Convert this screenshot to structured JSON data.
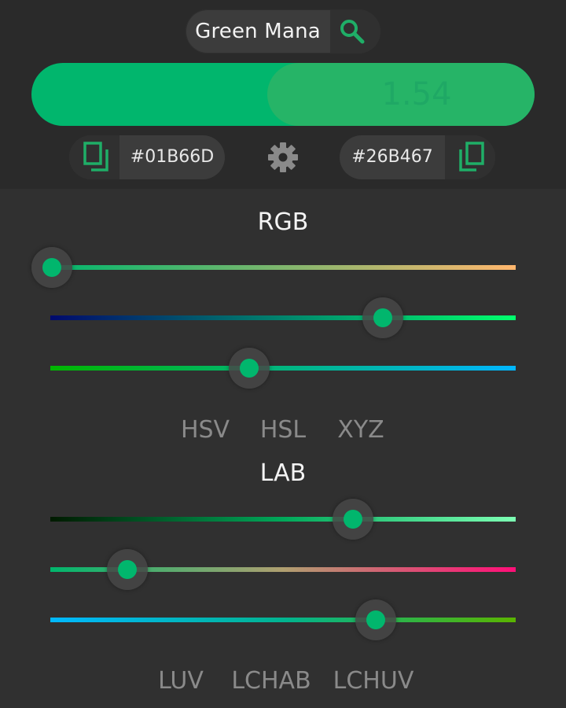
{
  "header": {
    "color_name": "Green Mana",
    "comparison_value": "1.54",
    "left_hex": "#01B66D",
    "right_hex": "#26B467",
    "left_color": "#01b66d",
    "right_color": "#26b467",
    "icons": {
      "search": "search-icon",
      "copy_left": "copy-icon",
      "settings": "gear-icon",
      "copy_right": "copy-icon"
    }
  },
  "rgb_section": {
    "title": "RGB",
    "sliders": [
      {
        "name": "rgb-slider-1",
        "value": 0.004,
        "gradient": [
          "#00b66d",
          "#ffb66d"
        ]
      },
      {
        "name": "rgb-slider-2",
        "value": 0.714,
        "gradient": [
          "#000a6d",
          "#01ff6d"
        ]
      },
      {
        "name": "rgb-slider-3",
        "value": 0.427,
        "gradient": [
          "#01b600",
          "#01b6ff"
        ]
      }
    ],
    "tabs": [
      "HSV",
      "HSL",
      "XYZ"
    ]
  },
  "lab_section": {
    "title": "LAB",
    "sliders": [
      {
        "name": "lab-slider-1",
        "value": 0.651,
        "gradient": [
          "#001a00",
          "#00a85a",
          "#7dffb4"
        ]
      },
      {
        "name": "lab-slider-2",
        "value": 0.166,
        "gradient": [
          "#00b66d",
          "#b0a070",
          "#ff0f78"
        ]
      },
      {
        "name": "lab-slider-3",
        "value": 0.699,
        "gradient": [
          "#00b8ff",
          "#00b490",
          "#5ab400"
        ]
      }
    ],
    "tabs": [
      "LUV",
      "LCHAB",
      "LCHUV"
    ]
  },
  "accent_color": "#01b66d"
}
